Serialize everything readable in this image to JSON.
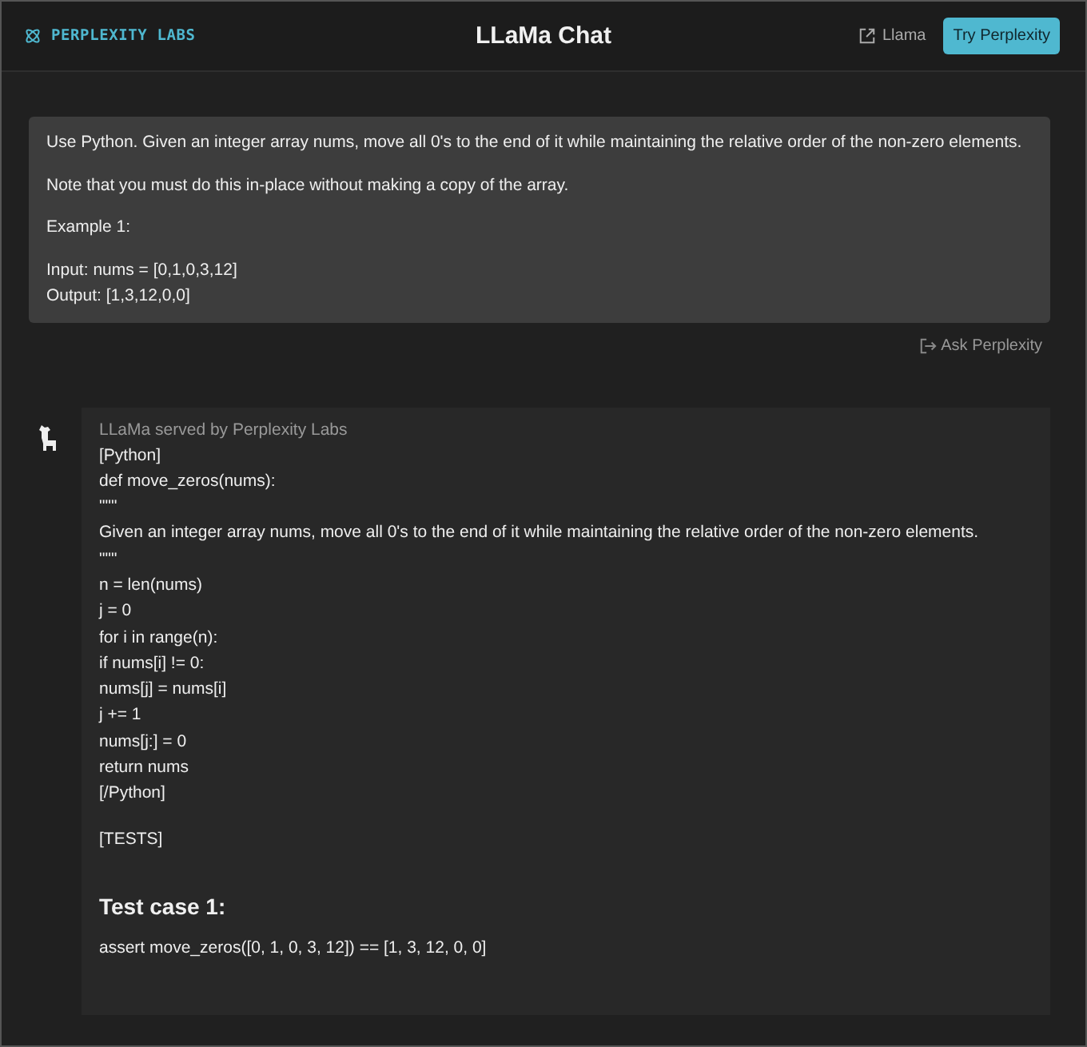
{
  "header": {
    "brand": "PERPLEXITY LABS",
    "title": "LLaMa Chat",
    "link": "Llama",
    "button": "Try Perplexity"
  },
  "prompt": {
    "paragraphs": [
      [
        "Use Python. Given an integer array nums, move all 0's to the end of it while maintaining the relative order of the non-zero elements."
      ],
      [
        "Note that you must do this in-place without making a copy of the array."
      ],
      [
        "Example 1:"
      ],
      [
        "Input: nums = [0,1,0,3,12]",
        "Output: [1,3,12,0,0]"
      ]
    ],
    "action": "Ask Perplexity"
  },
  "response": {
    "byline": "LLaMa served by Perplexity Labs",
    "blocks": [
      {
        "kind": "lines",
        "lines": [
          "[Python]",
          "def move_zeros(nums):",
          "\"\"\"",
          "Given an integer array nums, move all 0's to the end of it while maintaining the relative order of the non-zero elements.",
          "\"\"\"",
          "n = len(nums)",
          "j = 0",
          "for i in range(n):",
          "if nums[i] != 0:",
          "nums[j] = nums[i]",
          "j += 1",
          "nums[j:] = 0",
          "return nums",
          "[/Python]"
        ]
      },
      {
        "kind": "lines",
        "lines": [
          "[TESTS]"
        ]
      },
      {
        "kind": "heading",
        "text": "Test case 1:"
      },
      {
        "kind": "lines",
        "lines": [
          "assert move_zeros([0, 1, 0, 3, 12]) == [1, 3, 12, 0, 0]"
        ]
      }
    ]
  }
}
